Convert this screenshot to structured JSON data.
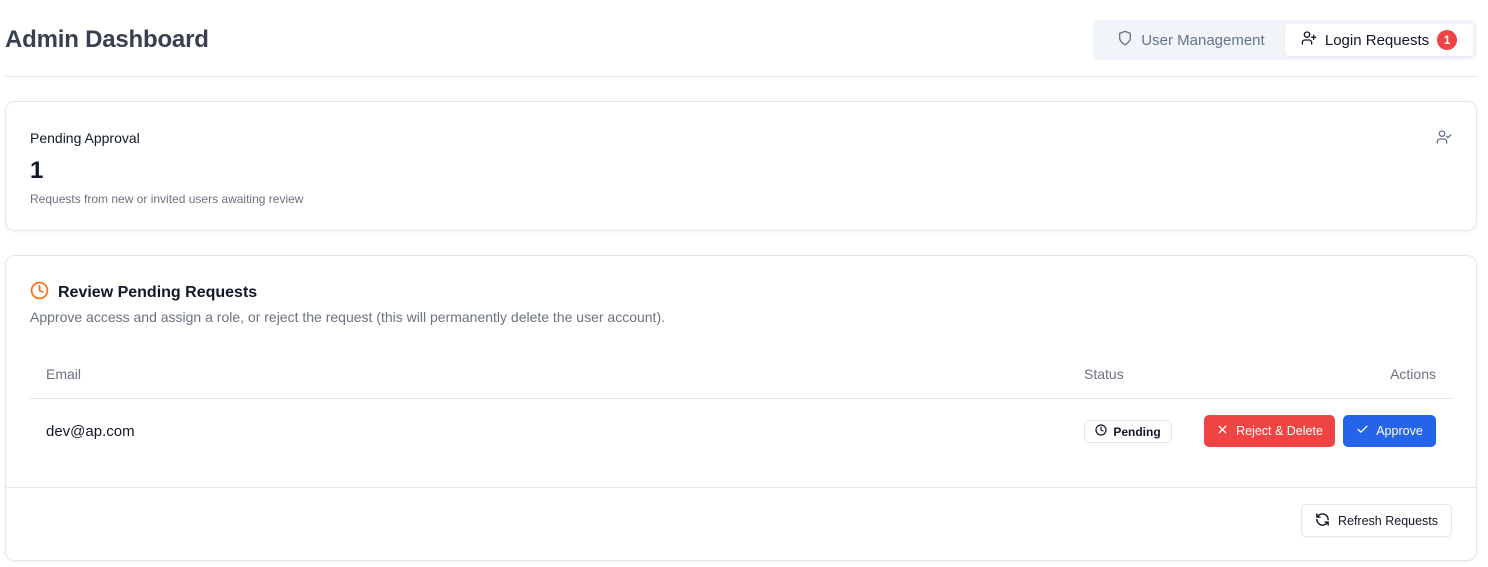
{
  "header": {
    "title": "Admin Dashboard",
    "tabs": [
      {
        "label": "User Management",
        "icon": "shield-icon",
        "active": false
      },
      {
        "label": "Login Requests",
        "icon": "user-plus-icon",
        "active": true,
        "badge": "1"
      }
    ]
  },
  "stats": {
    "label": "Pending Approval",
    "value": "1",
    "description": "Requests from new or invited users awaiting review",
    "icon": "user-check-icon"
  },
  "review": {
    "title": "Review Pending Requests",
    "title_icon": "clock-icon",
    "description": "Approve access and assign a role, or reject the request (this will permanently delete the user account).",
    "columns": {
      "email": "Email",
      "status": "Status",
      "actions": "Actions"
    },
    "rows": [
      {
        "email": "dev@ap.com",
        "status": "Pending",
        "reject_label": "Reject & Delete",
        "approve_label": "Approve"
      }
    ],
    "refresh_label": "Refresh Requests"
  },
  "colors": {
    "reject": "#ef4444",
    "approve": "#2563eb",
    "badge": "#ef4444",
    "accent_clock": "#f97316"
  }
}
